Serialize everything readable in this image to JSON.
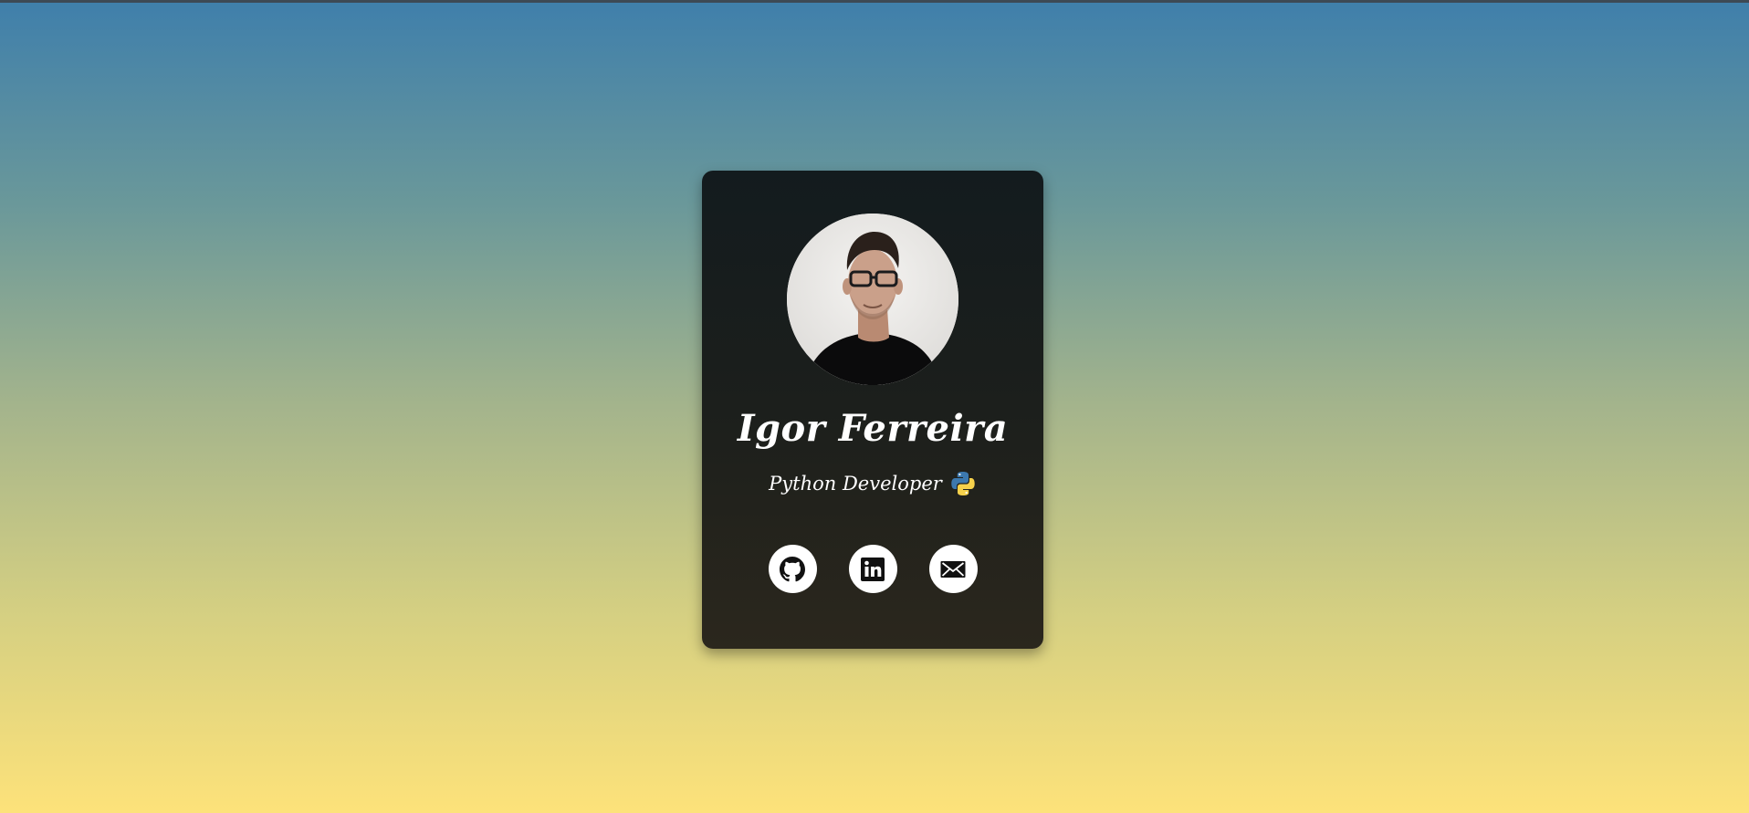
{
  "profile": {
    "name": "Igor Ferreira",
    "role": "Python Developer",
    "role_icon": "python-logo-icon"
  },
  "socials": [
    {
      "icon": "github-icon"
    },
    {
      "icon": "linkedin-icon"
    },
    {
      "icon": "mail-icon"
    }
  ],
  "colors": {
    "background_top": "#3f7fab",
    "background_bottom": "#fde27a",
    "card_top": "#131b1e",
    "card_bottom": "#2b271d",
    "text": "#ffffff",
    "social_bg": "#ffffff"
  }
}
